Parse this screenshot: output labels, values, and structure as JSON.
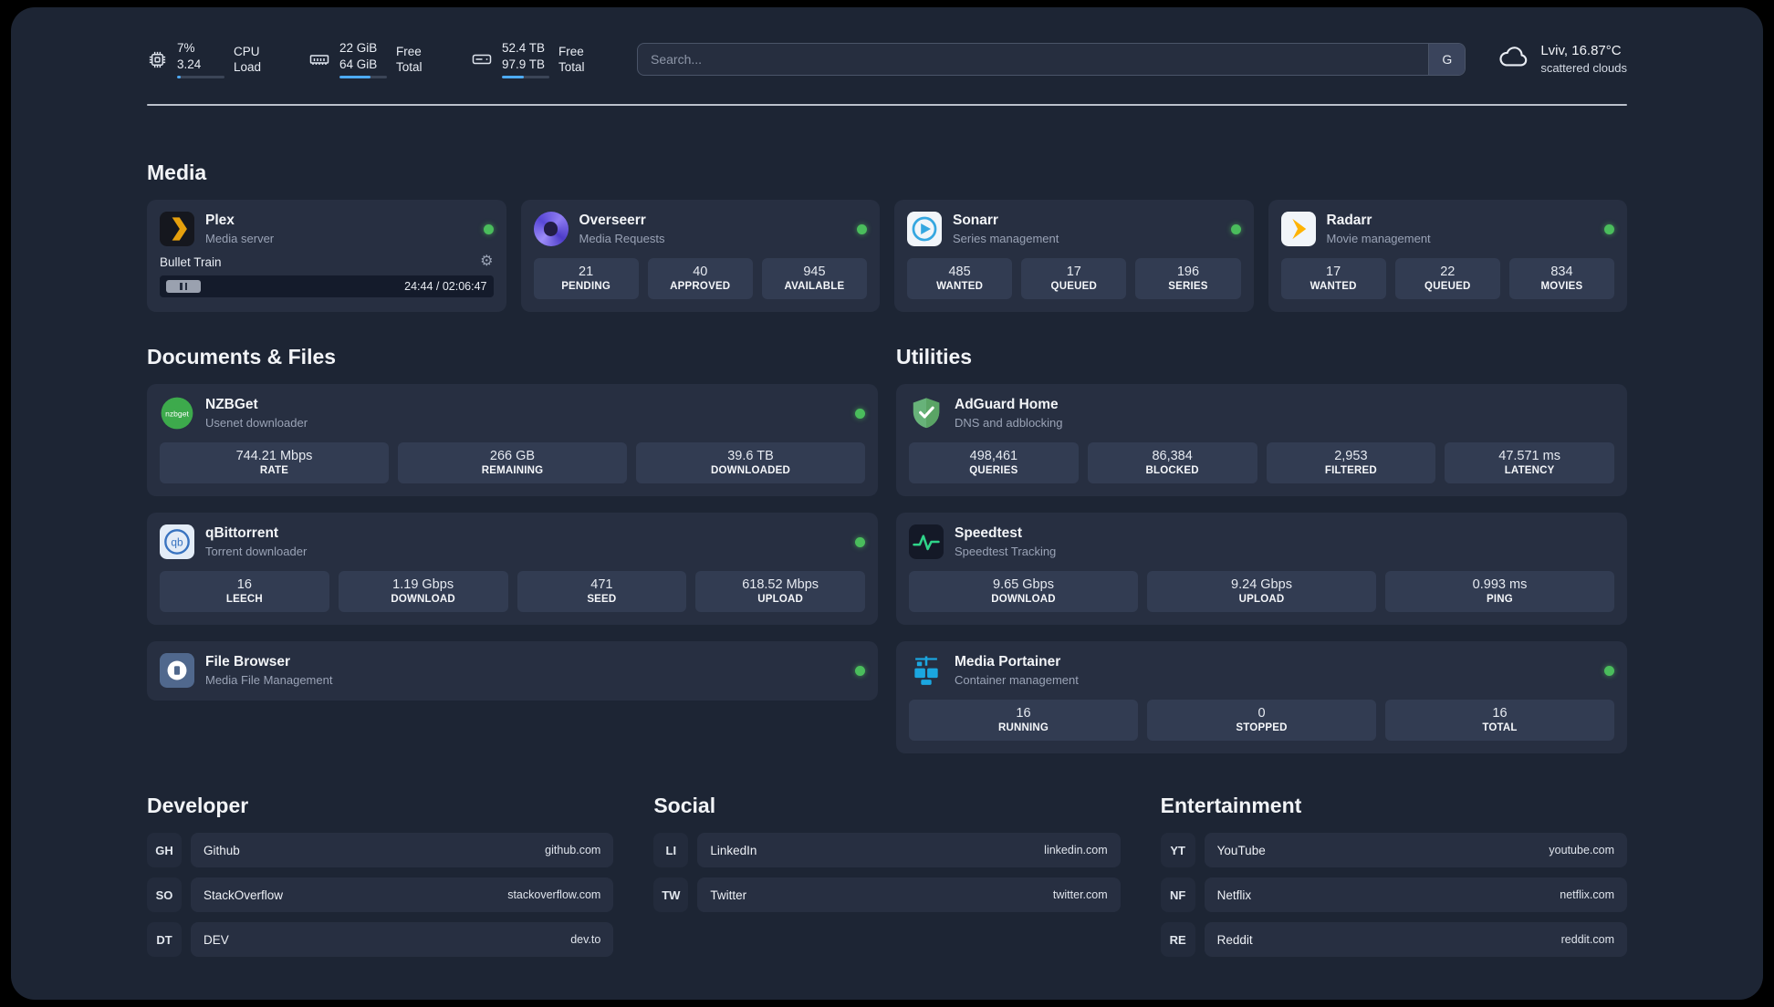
{
  "topbar": {
    "cpu": {
      "value_top": "7%",
      "value_bottom": "3.24",
      "label_top": "CPU",
      "label_bottom": "Load",
      "usage_percent": 8
    },
    "ram": {
      "value_top": "22 GiB",
      "value_bottom": "64 GiB",
      "label_top": "Free",
      "label_bottom": "Total",
      "usage_percent": 66
    },
    "disk": {
      "value_top": "52.4 TB",
      "value_bottom": "97.9 TB",
      "label_top": "Free",
      "label_bottom": "Total",
      "usage_percent": 47
    },
    "search": {
      "placeholder": "Search...",
      "engine_label": "G"
    },
    "weather": {
      "location": "Lviv, 16.87°C",
      "condition": "scattered clouds",
      "icon": "cloud-icon"
    }
  },
  "sections": {
    "media": {
      "title": "Media",
      "plex": {
        "name": "Plex",
        "subtitle": "Media server",
        "icon": "plex-icon",
        "status_color": "#4abd5c",
        "now_playing": {
          "track": "Bullet Train",
          "time": "24:44 / 02:06:47",
          "state": "paused"
        }
      },
      "overseerr": {
        "name": "Overseerr",
        "subtitle": "Media Requests",
        "icon": "overseerr-icon",
        "status_color": "#4abd5c",
        "stats": [
          {
            "value": "21",
            "label": "PENDING"
          },
          {
            "value": "40",
            "label": "APPROVED"
          },
          {
            "value": "945",
            "label": "AVAILABLE"
          }
        ]
      },
      "sonarr": {
        "name": "Sonarr",
        "subtitle": "Series management",
        "icon": "sonarr-icon",
        "status_color": "#4abd5c",
        "stats": [
          {
            "value": "485",
            "label": "WANTED"
          },
          {
            "value": "17",
            "label": "QUEUED"
          },
          {
            "value": "196",
            "label": "SERIES"
          }
        ]
      },
      "radarr": {
        "name": "Radarr",
        "subtitle": "Movie management",
        "icon": "radarr-icon",
        "status_color": "#4abd5c",
        "stats": [
          {
            "value": "17",
            "label": "WANTED"
          },
          {
            "value": "22",
            "label": "QUEUED"
          },
          {
            "value": "834",
            "label": "MOVIES"
          }
        ]
      }
    },
    "documents": {
      "title": "Documents & Files",
      "nzbget": {
        "name": "NZBGet",
        "subtitle": "Usenet downloader",
        "icon": "nzbget-icon",
        "icon_text": "nzbget",
        "status_color": "#4abd5c",
        "stats": [
          {
            "value": "744.21 Mbps",
            "label": "RATE"
          },
          {
            "value": "266 GB",
            "label": "REMAINING"
          },
          {
            "value": "39.6 TB",
            "label": "DOWNLOADED"
          }
        ]
      },
      "qbittorrent": {
        "name": "qBittorrent",
        "subtitle": "Torrent downloader",
        "icon": "qbittorrent-icon",
        "icon_text": "qb",
        "status_color": "#4abd5c",
        "stats": [
          {
            "value": "16",
            "label": "LEECH"
          },
          {
            "value": "1.19 Gbps",
            "label": "DOWNLOAD"
          },
          {
            "value": "471",
            "label": "SEED"
          },
          {
            "value": "618.52 Mbps",
            "label": "UPLOAD"
          }
        ]
      },
      "filebrowser": {
        "name": "File Browser",
        "subtitle": "Media File Management",
        "icon": "filebrowser-icon",
        "status_color": "#4abd5c"
      }
    },
    "utilities": {
      "title": "Utilities",
      "adguard": {
        "name": "AdGuard Home",
        "subtitle": "DNS and adblocking",
        "icon": "adguard-icon",
        "stats": [
          {
            "value": "498,461",
            "label": "QUERIES"
          },
          {
            "value": "86,384",
            "label": "BLOCKED"
          },
          {
            "value": "2,953",
            "label": "FILTERED"
          },
          {
            "value": "47.571 ms",
            "label": "LATENCY"
          }
        ]
      },
      "speedtest": {
        "name": "Speedtest",
        "subtitle": "Speedtest Tracking",
        "icon": "speedtest-icon",
        "stats": [
          {
            "value": "9.65 Gbps",
            "label": "DOWNLOAD"
          },
          {
            "value": "9.24 Gbps",
            "label": "UPLOAD"
          },
          {
            "value": "0.993 ms",
            "label": "PING"
          }
        ]
      },
      "portainer": {
        "name": "Media Portainer",
        "subtitle": "Container management",
        "icon": "portainer-icon",
        "status_color": "#4abd5c",
        "stats": [
          {
            "value": "16",
            "label": "RUNNING"
          },
          {
            "value": "0",
            "label": "STOPPED"
          },
          {
            "value": "16",
            "label": "TOTAL"
          }
        ]
      }
    }
  },
  "bookmarks": {
    "developer": {
      "title": "Developer",
      "items": [
        {
          "abbr": "GH",
          "name": "Github",
          "url": "github.com"
        },
        {
          "abbr": "SO",
          "name": "StackOverflow",
          "url": "stackoverflow.com"
        },
        {
          "abbr": "DT",
          "name": "DEV",
          "url": "dev.to"
        }
      ]
    },
    "social": {
      "title": "Social",
      "items": [
        {
          "abbr": "LI",
          "name": "LinkedIn",
          "url": "linkedin.com"
        },
        {
          "abbr": "TW",
          "name": "Twitter",
          "url": "twitter.com"
        }
      ]
    },
    "entertainment": {
      "title": "Entertainment",
      "items": [
        {
          "abbr": "YT",
          "name": "YouTube",
          "url": "youtube.com"
        },
        {
          "abbr": "NF",
          "name": "Netflix",
          "url": "netflix.com"
        },
        {
          "abbr": "RE",
          "name": "Reddit",
          "url": "reddit.com"
        }
      ]
    }
  },
  "colors": {
    "status_online": "#4abd5c",
    "accent": "#4dabf7",
    "background": "#1d2534",
    "card": "#272f41",
    "tile": "#323c52"
  }
}
